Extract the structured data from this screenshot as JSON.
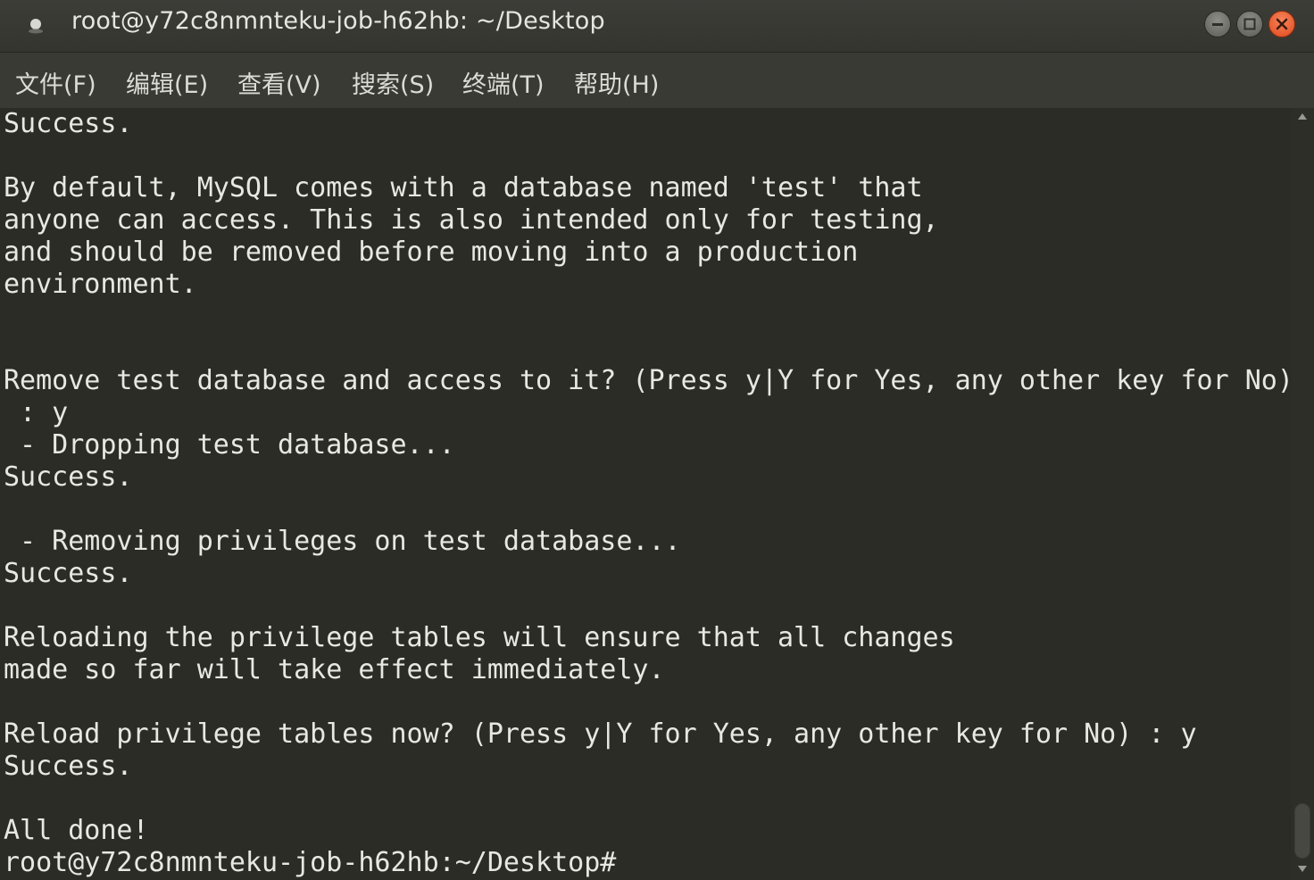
{
  "window": {
    "title": "root@y72c8nmnteku-job-h62hb: ~/Desktop",
    "controls": {
      "minimize": "minimize-icon",
      "maximize": "maximize-icon",
      "close": "close-icon"
    }
  },
  "menubar": {
    "items": [
      {
        "label": "文件(F)"
      },
      {
        "label": "编辑(E)"
      },
      {
        "label": "查看(V)"
      },
      {
        "label": "搜索(S)"
      },
      {
        "label": "终端(T)"
      },
      {
        "label": "帮助(H)"
      }
    ]
  },
  "terminal": {
    "lines": [
      "Success.",
      "",
      "By default, MySQL comes with a database named 'test' that",
      "anyone can access. This is also intended only for testing,",
      "and should be removed before moving into a production",
      "environment.",
      "",
      "",
      "Remove test database and access to it? (Press y|Y for Yes, any other key for No)",
      " : y",
      " - Dropping test database...",
      "Success.",
      "",
      " - Removing privileges on test database...",
      "Success.",
      "",
      "Reloading the privilege tables will ensure that all changes",
      "made so far will take effect immediately.",
      "",
      "Reload privilege tables now? (Press y|Y for Yes, any other key for No) : y",
      "Success.",
      "",
      "All done!",
      "root@y72c8nmnteku-job-h62hb:~/Desktop#"
    ]
  },
  "colors": {
    "background": "#2c2c27",
    "text": "#e8e8e3",
    "close_button": "#e05a2a"
  }
}
